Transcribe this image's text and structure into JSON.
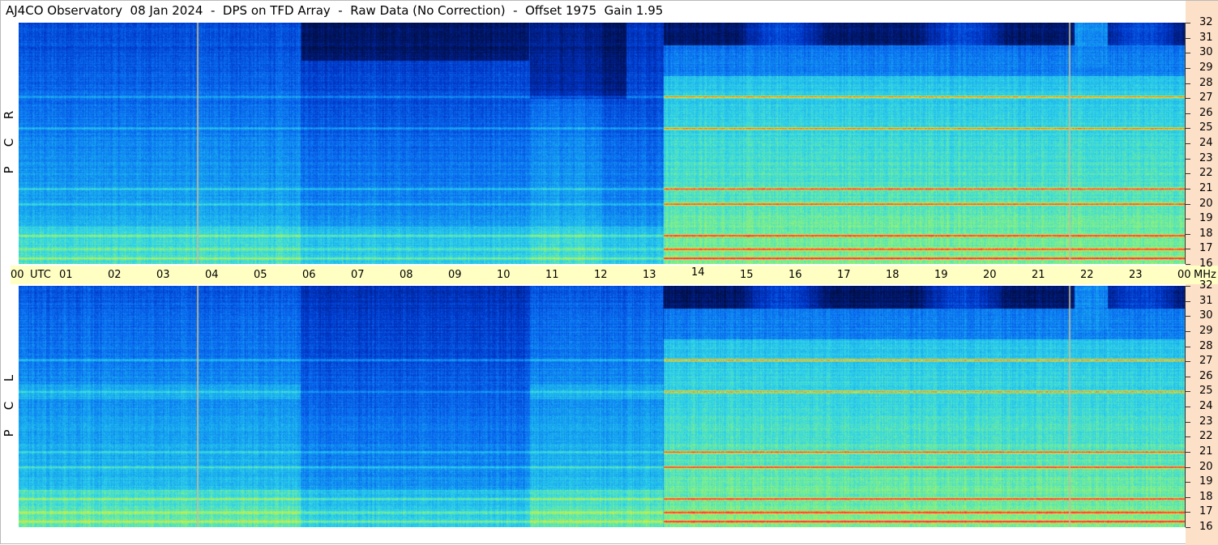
{
  "header": {
    "title": "AJ4CO Observatory  08 Jan 2024  -  DPS on TFD Array  -  Raw Data (No Correction)  -  Offset 1975  Gain 1.95"
  },
  "chart_data": {
    "type": "heatmap",
    "x_ticks": [
      "00",
      "01",
      "02",
      "03",
      "04",
      "05",
      "06",
      "07",
      "08",
      "09",
      "10",
      "11",
      "12",
      "13",
      "14",
      "15",
      "16",
      "17",
      "18",
      "19",
      "20",
      "21",
      "22",
      "23",
      "00"
    ],
    "x_unit_label": "UTC",
    "y_unit_label": "MHz",
    "y_ticks": [
      32,
      31,
      30,
      29,
      28,
      27,
      26,
      25,
      24,
      23,
      22,
      21,
      20,
      19,
      18,
      17,
      16
    ],
    "xlim_hours_utc": [
      0,
      24
    ],
    "ylim_mhz": [
      16,
      32
    ],
    "colormap": [
      "#000a2e",
      "#001a78",
      "#0036c8",
      "#0a6cf0",
      "#17a8f0",
      "#33d6e6",
      "#7ef08a",
      "#d8ec3c",
      "#ff7a1e",
      "#ff2a5a",
      "#c030c8"
    ],
    "panels": [
      {
        "name": "top",
        "polarization": [
          "R",
          "C",
          "P"
        ],
        "sunrise_hour": 13.25,
        "high_power_bands_mhz": [
          27.1,
          25.0,
          21.0,
          20.0,
          17.9,
          17.0,
          16.4
        ]
      },
      {
        "name": "bottom",
        "polarization": [
          "L",
          "C",
          "P"
        ],
        "sunrise_hour": 13.25,
        "high_power_bands_mhz": [
          27.1,
          25.0,
          21.0,
          20.0,
          17.9,
          17.0,
          16.4
        ]
      }
    ],
    "vertical_markers_hours": [
      3.67,
      21.6
    ]
  }
}
